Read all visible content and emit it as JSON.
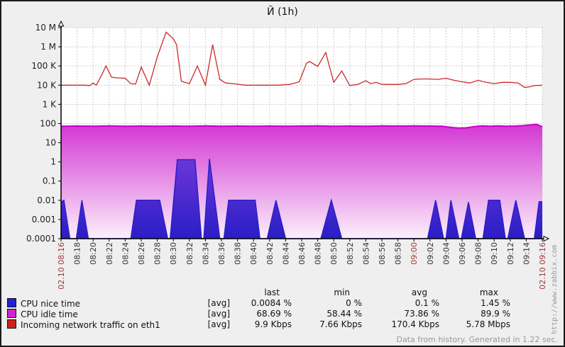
{
  "title": "Й (1h)",
  "watermark": "http://www.zabbix.com",
  "footer": "Data from history. Generated in 1.22 sec.",
  "colors": {
    "traffic_line": "#cc2929",
    "nice_fill_top": "#6d36d8",
    "nice_fill_bottom": "#2a1ec6",
    "nice_edge": "#2a20c8",
    "idle_edge": "#cc00cc",
    "idle_fill_top": "#d336d3",
    "idle_fill_bottom": "#fbeffb",
    "grid": "#cccccc",
    "axis": "#000000",
    "tick_label": "#333333",
    "tick_label_red": "#9c3a3a",
    "plot_bg": "#ffffff"
  },
  "chart_data": {
    "type": "area",
    "title": "Й (1h)",
    "y_scale": "log",
    "y_log_min": 0.0001,
    "y_log_max": 10000000,
    "x_range_minutes": 60,
    "grid": true,
    "legend_position": "bottom",
    "y_ticks": [
      "10 M",
      "1 M",
      "100 K",
      "10 K",
      "1 K",
      "100",
      "10",
      "1",
      "0.1",
      "0.01",
      "0.001",
      "0.0001"
    ],
    "x_ticks": [
      "02.10 08:16",
      "08:18",
      "08:20",
      "08:22",
      "08:24",
      "08:26",
      "08:28",
      "08:30",
      "08:32",
      "08:34",
      "08:36",
      "08:38",
      "08:40",
      "08:42",
      "08:44",
      "08:46",
      "08:48",
      "08:50",
      "08:52",
      "08:54",
      "08:56",
      "08:58",
      "09:00",
      "09:02",
      "09:04",
      "09:06",
      "09:08",
      "09:10",
      "09:12",
      "09:14",
      "02.10 09:16"
    ],
    "x_tick_red_indices": [
      0,
      22,
      30
    ],
    "series": [
      {
        "name": "CPU idle time",
        "type": "area",
        "unit": "%",
        "points": [
          [
            0,
            72
          ],
          [
            2,
            74
          ],
          [
            4,
            73
          ],
          [
            6,
            75
          ],
          [
            8,
            73
          ],
          [
            10,
            74
          ],
          [
            12,
            72
          ],
          [
            14,
            74
          ],
          [
            16,
            73
          ],
          [
            18,
            75
          ],
          [
            20,
            73
          ],
          [
            22,
            74
          ],
          [
            24,
            72
          ],
          [
            26,
            74
          ],
          [
            28,
            73
          ],
          [
            30,
            74
          ],
          [
            32,
            75
          ],
          [
            34,
            73
          ],
          [
            36,
            74
          ],
          [
            38,
            73
          ],
          [
            40,
            75
          ],
          [
            42,
            74
          ],
          [
            44,
            76
          ],
          [
            46,
            74
          ],
          [
            47.5,
            72
          ],
          [
            48.8,
            62
          ],
          [
            49.6,
            58.44
          ],
          [
            50.5,
            60
          ],
          [
            51.5,
            70
          ],
          [
            52.5,
            75
          ],
          [
            53.5,
            73
          ],
          [
            54.5,
            75
          ],
          [
            55.5,
            72
          ],
          [
            56.5,
            74
          ],
          [
            57.5,
            78
          ],
          [
            58.5,
            85
          ],
          [
            59.3,
            89.9
          ],
          [
            60,
            68.69
          ]
        ]
      },
      {
        "name": "CPU nice time",
        "type": "area",
        "unit": "%",
        "points": [
          [
            0,
            0.008
          ],
          [
            0.35,
            0.01
          ],
          [
            1.1,
            0.0001
          ],
          [
            1.9,
            0.0001
          ],
          [
            2.6,
            0.01
          ],
          [
            3.4,
            0.0001
          ],
          [
            8.7,
            0.0001
          ],
          [
            9.4,
            0.01
          ],
          [
            12.3,
            0.01
          ],
          [
            13.3,
            0.0001
          ],
          [
            13.6,
            0.0001
          ],
          [
            14.5,
            1.3
          ],
          [
            16.7,
            1.3
          ],
          [
            17.5,
            0.0001
          ],
          [
            17.8,
            0.0001
          ],
          [
            18.5,
            1.45
          ],
          [
            19.8,
            0.0001
          ],
          [
            20.3,
            0.0001
          ],
          [
            20.9,
            0.01
          ],
          [
            24.2,
            0.01
          ],
          [
            24.8,
            0.0001
          ],
          [
            25.7,
            0.0001
          ],
          [
            26.8,
            0.01
          ],
          [
            28,
            0.0001
          ],
          [
            32.4,
            0.0001
          ],
          [
            33.7,
            0.01
          ],
          [
            35,
            0.0001
          ],
          [
            45.7,
            0.0001
          ],
          [
            46.7,
            0.01
          ],
          [
            47.7,
            0.0001
          ],
          [
            48,
            0.0001
          ],
          [
            48.6,
            0.01
          ],
          [
            49.6,
            0.0001
          ],
          [
            49.9,
            0.0001
          ],
          [
            50.8,
            0.008
          ],
          [
            51.7,
            0.0001
          ],
          [
            52.6,
            0.0001
          ],
          [
            53.3,
            0.01
          ],
          [
            54.7,
            0.01
          ],
          [
            55.4,
            0.0001
          ],
          [
            55.7,
            0.0001
          ],
          [
            56.7,
            0.01
          ],
          [
            57.8,
            0.0001
          ],
          [
            59,
            0.0001
          ],
          [
            59.6,
            0.0084
          ],
          [
            60,
            0.0084
          ]
        ]
      },
      {
        "name": "Incoming network traffic on eth1",
        "type": "line",
        "unit": "bps",
        "points": [
          [
            0,
            10000
          ],
          [
            1,
            10000
          ],
          [
            2,
            10000
          ],
          [
            3,
            10000
          ],
          [
            3.6,
            9500
          ],
          [
            4,
            13000
          ],
          [
            4.4,
            10000
          ],
          [
            5,
            30000
          ],
          [
            5.6,
            100000
          ],
          [
            6.3,
            26000
          ],
          [
            7,
            24000
          ],
          [
            8,
            23000
          ],
          [
            8.7,
            12000
          ],
          [
            9.3,
            11500
          ],
          [
            10,
            88000
          ],
          [
            11,
            10000
          ],
          [
            12,
            300000
          ],
          [
            13.1,
            5780000
          ],
          [
            14,
            2600000
          ],
          [
            14.4,
            1300000
          ],
          [
            15,
            16000
          ],
          [
            16,
            12000
          ],
          [
            17,
            100000
          ],
          [
            18,
            10000
          ],
          [
            18.9,
            1300000
          ],
          [
            19.8,
            20000
          ],
          [
            20.5,
            13000
          ],
          [
            21.5,
            12000
          ],
          [
            23,
            10000
          ],
          [
            25,
            10000
          ],
          [
            27,
            10000
          ],
          [
            28.5,
            11000
          ],
          [
            29.7,
            15000
          ],
          [
            30.6,
            140000
          ],
          [
            31,
            170000
          ],
          [
            32,
            95000
          ],
          [
            33,
            500000
          ],
          [
            34,
            14000
          ],
          [
            35,
            55000
          ],
          [
            36,
            9500
          ],
          [
            37,
            11000
          ],
          [
            38,
            17000
          ],
          [
            38.6,
            12000
          ],
          [
            39.3,
            14000
          ],
          [
            40,
            11000
          ],
          [
            41,
            11000
          ],
          [
            42,
            11000
          ],
          [
            43,
            12000
          ],
          [
            44,
            20000
          ],
          [
            45,
            21000
          ],
          [
            46,
            21000
          ],
          [
            47,
            20000
          ],
          [
            48,
            23000
          ],
          [
            49,
            18000
          ],
          [
            50,
            15000
          ],
          [
            51,
            13000
          ],
          [
            52,
            18000
          ],
          [
            53,
            14000
          ],
          [
            54,
            12000
          ],
          [
            55,
            14000
          ],
          [
            56,
            14000
          ],
          [
            57,
            13000
          ],
          [
            57.8,
            7660
          ],
          [
            58.3,
            8000
          ],
          [
            59,
            9500
          ],
          [
            60,
            9900
          ]
        ]
      }
    ]
  },
  "legend": {
    "headers": [
      "last",
      "min",
      "avg",
      "max"
    ],
    "rows": [
      {
        "label": "CPU nice time",
        "scope": "[avg]",
        "color": "#2121d6",
        "last": "0.0084 %",
        "min": "0 %",
        "avg": "0.1 %",
        "max": "1.45 %"
      },
      {
        "label": "CPU idle time",
        "scope": "[avg]",
        "color": "#cf25cf",
        "last": "68.69 %",
        "min": "58.44 %",
        "avg": "73.86 %",
        "max": "89.9 %"
      },
      {
        "label": "Incoming network traffic on eth1",
        "scope": "[avg]",
        "color": "#d11f1f",
        "last": "9.9 Kbps",
        "min": "7.66 Kbps",
        "avg": "170.4 Kbps",
        "max": "5.78 Mbps"
      }
    ]
  }
}
